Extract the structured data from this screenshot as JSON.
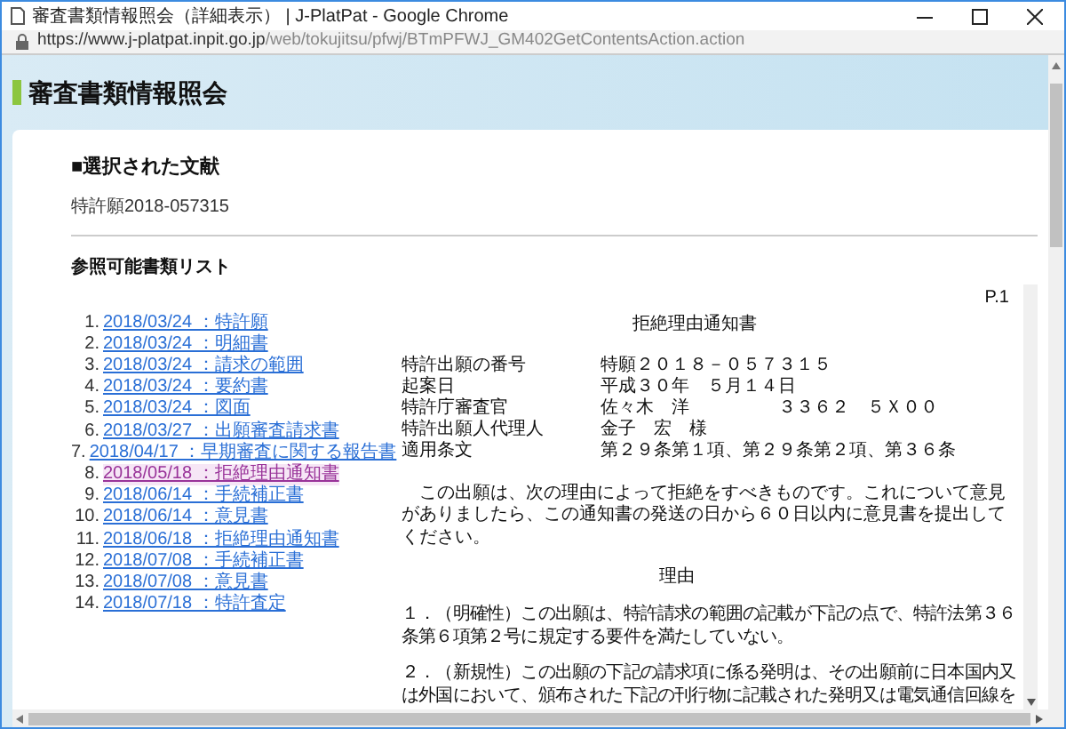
{
  "window": {
    "title": "審査書類情報照会（詳細表示） | J-PlatPat - Google Chrome"
  },
  "address_bar": {
    "host": "https://www.j-platpat.inpit.go.jp",
    "path": "/web/tokujitsu/pfwj/BTmPFWJ_GM402GetContentsAction.action"
  },
  "page_header": {
    "title": "審査書類情報照会"
  },
  "selected_document": {
    "heading": "■選択された文献",
    "number": "特許願2018-057315"
  },
  "document_list": {
    "heading": "参照可能書類リスト",
    "items": [
      {
        "number": "1.",
        "label": "2018/03/24 ：特許願",
        "selected": false
      },
      {
        "number": "2.",
        "label": "2018/03/24 ：明細書",
        "selected": false
      },
      {
        "number": "3.",
        "label": "2018/03/24 ：請求の範囲",
        "selected": false
      },
      {
        "number": "4.",
        "label": "2018/03/24 ：要約書",
        "selected": false
      },
      {
        "number": "5.",
        "label": "2018/03/24 ：図面",
        "selected": false
      },
      {
        "number": "6.",
        "label": "2018/03/27 ：出願審査請求書",
        "selected": false
      },
      {
        "number": "7.",
        "label": "2018/04/17 ：早期審査に関する報告書",
        "selected": false
      },
      {
        "number": "8.",
        "label": "2018/05/18 ：拒絶理由通知書",
        "selected": true
      },
      {
        "number": "9.",
        "label": "2018/06/14 ：手続補正書",
        "selected": false
      },
      {
        "number": "10.",
        "label": "2018/06/14 ：意見書",
        "selected": false
      },
      {
        "number": "11.",
        "label": "2018/06/18 ：拒絶理由通知書",
        "selected": false
      },
      {
        "number": "12.",
        "label": "2018/07/08 ：手続補正書",
        "selected": false
      },
      {
        "number": "13.",
        "label": "2018/07/08 ：意見書",
        "selected": false
      },
      {
        "number": "14.",
        "label": "2018/07/18 ：特許査定",
        "selected": false
      }
    ]
  },
  "document": {
    "page": "P.1",
    "title": "拒絶理由通知書",
    "fields": [
      {
        "label": "特許出願の番号",
        "value": "特願２０１８－０５７３１５"
      },
      {
        "label": "起案日",
        "value": "平成３０年　５月１４日"
      },
      {
        "label": "特許庁審査官",
        "value": "佐々木　洋",
        "extra": "３３６２　５Ｘ００"
      },
      {
        "label": "特許出願人代理人",
        "value": "金子　宏　様"
      },
      {
        "label": "適用条文",
        "value": "第２９条第１項、第２９条第２項、第３６条"
      }
    ],
    "intro": "　この出願は、次の理由によって拒絶をすべきものです。これについて意見がありましたら、この通知書の発送の日から６０日以内に意見書を提出してください。",
    "reason_heading": "理由",
    "reasons": [
      "１．（明確性）この出願は、特許請求の範囲の記載が下記の点で、特許法第３６条第６項第２号に規定する要件を満たしていない。",
      "２．（新規性）この出願の下記の請求項に係る発明は、その出願前に日本国内又は外国において、頒布された下記の刊行物に記載された発明又は電気通信回線を"
    ]
  }
}
